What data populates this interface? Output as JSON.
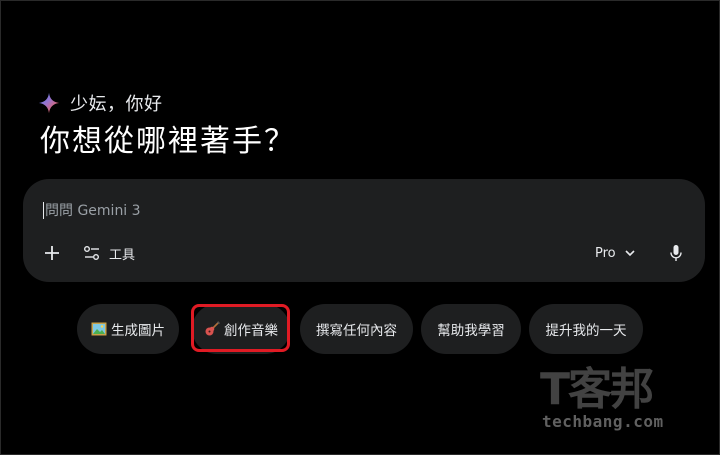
{
  "greeting": {
    "name_text": "少妘，你好",
    "headline": "你想從哪裡著手？"
  },
  "composer": {
    "prompt_text": "問問 Gemini 3",
    "add_icon": "plus-icon",
    "tools_icon": "tune-icon",
    "tools_label": "工具",
    "model_label": "Pro",
    "model_chevron": "chevron-down-icon",
    "mic_icon": "mic-icon"
  },
  "suggestions": [
    {
      "emoji": "🖼️",
      "label": "生成圖片"
    },
    {
      "emoji": "🎸",
      "label": "創作音樂"
    },
    {
      "emoji": "",
      "label": "撰寫任何內容"
    },
    {
      "emoji": "",
      "label": "幫助我學習"
    },
    {
      "emoji": "",
      "label": "提升我的一天"
    }
  ],
  "highlight": {
    "color": "#e01b24",
    "target": "創作音樂"
  },
  "watermark": {
    "logo": "T客邦",
    "url": "techbang.com"
  },
  "colors": {
    "background": "#000000",
    "surface": "#1e1f20",
    "text": "#e8eaed",
    "placeholder": "#9aa0a6"
  }
}
